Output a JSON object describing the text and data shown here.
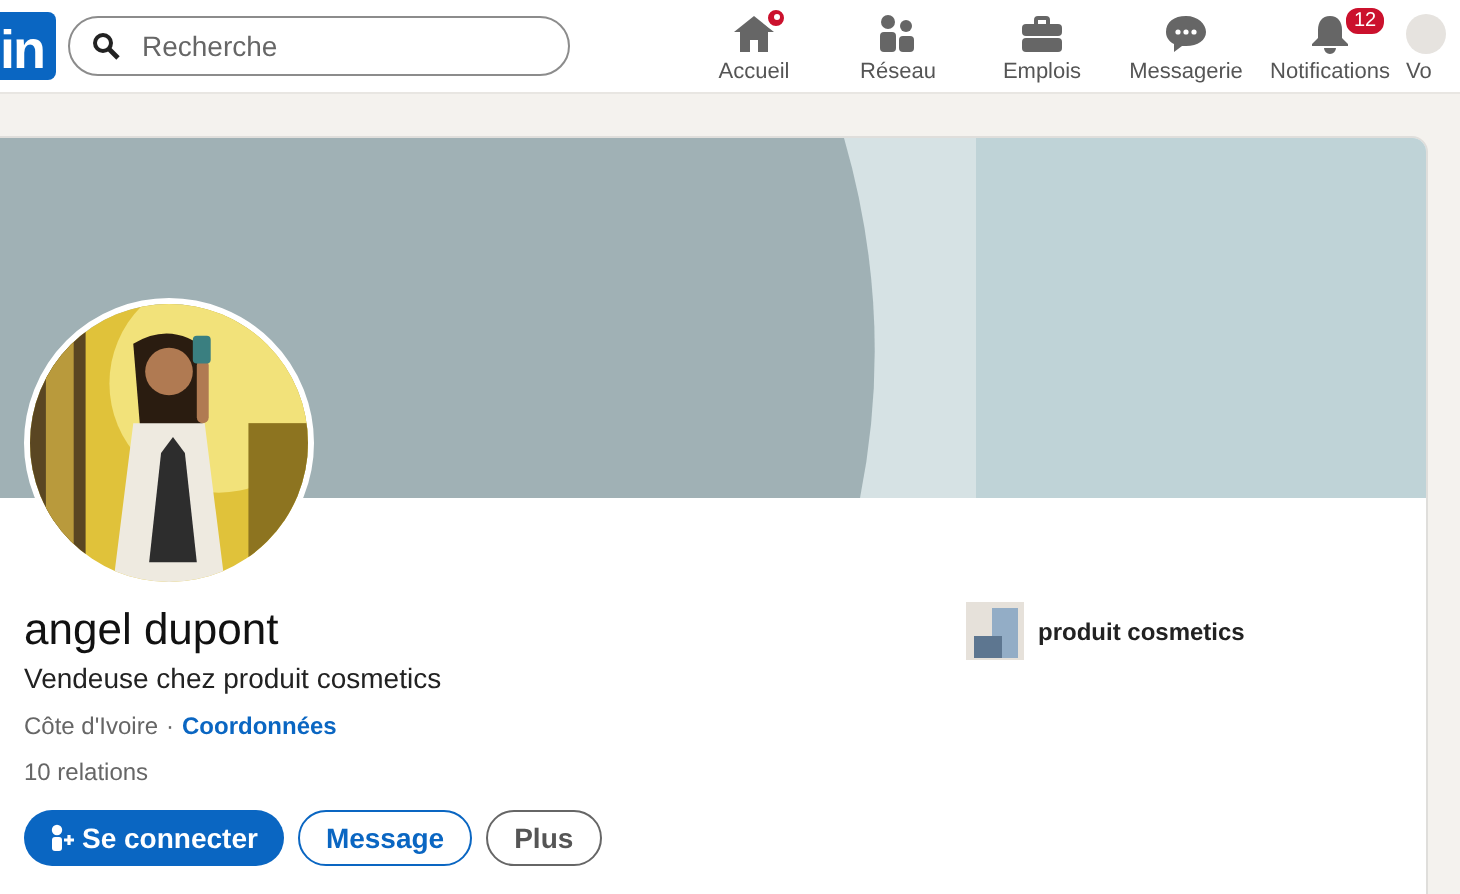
{
  "logo": {
    "text": "in"
  },
  "search": {
    "placeholder": "Recherche"
  },
  "nav": [
    {
      "label": "Accueil",
      "kind": "home",
      "badge_dot": true
    },
    {
      "label": "Réseau",
      "kind": "network"
    },
    {
      "label": "Emplois",
      "kind": "jobs"
    },
    {
      "label": "Messagerie",
      "kind": "messages"
    },
    {
      "label": "Notifications",
      "kind": "bell",
      "badge": "12"
    },
    {
      "label": "Vo",
      "kind": "avatar"
    }
  ],
  "profile": {
    "name": "angel dupont",
    "headline": "Vendeuse chez produit cosmetics",
    "location": "Côte d'Ivoire",
    "separator": "·",
    "contact_link": "Coordonnées",
    "connections": "10 relations",
    "company": "produit cosmetics"
  },
  "actions": [
    {
      "label": "Se connecter",
      "kind": "primary"
    },
    {
      "label": "Message",
      "kind": "outline"
    },
    {
      "label": "Plus",
      "kind": "secondary"
    }
  ]
}
